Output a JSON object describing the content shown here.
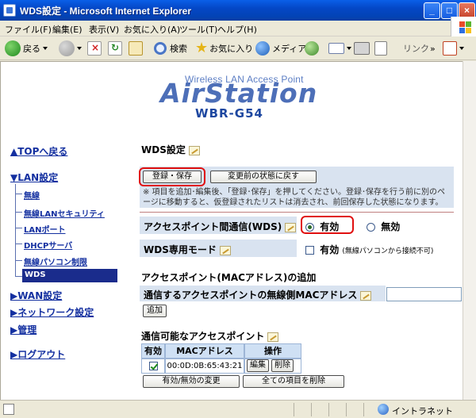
{
  "window": {
    "title": "WDS設定 - Microsoft Internet Explorer"
  },
  "menu": [
    "ファイル(F)",
    "編集(E)",
    "表示(V)",
    "お気に入り(A)",
    "ツール(T)",
    "ヘルプ(H)"
  ],
  "toolbar": {
    "back": "戻る",
    "search": "検索",
    "favorites": "お気に入り",
    "media": "メディア",
    "links": "リンク"
  },
  "logo": {
    "subtitle": "Wireless LAN Access Point",
    "brand": "AirStation",
    "model": "WBR-G54"
  },
  "nav": {
    "top": "▲TOPへ戻る",
    "lan": "▼LAN設定",
    "lan_items": [
      "無線",
      "無線LANセキュリティ",
      "LANポート",
      "DHCPサーバ",
      "無線パソコン制限",
      "WDS"
    ],
    "wan": "▶WAN設定",
    "network": "▶ネットワーク設定",
    "admin": "▶管理",
    "logout": "▶ログアウト"
  },
  "main": {
    "title": "WDS設定",
    "save_button": "登録・保存",
    "revert_button": "変更前の状態に戻す",
    "note": "※ 項目を追加･編集後、「登録･保存」を押してください。登録･保存を行う前に別のページに移動すると、仮登録されたリストは消去され、前回保存した状態になります。",
    "wds_label": "アクセスポイント間通信(WDS)",
    "enabled": "有効",
    "disabled": "無効",
    "wds_only_label": "WDS専用モード",
    "wds_only_enabled": "有効",
    "wds_only_note": "(無線パソコンから接続不可)",
    "add_heading": "アクセスポイント(MACアドレス)の追加",
    "mac_input_label": "通信するアクセスポイントの無線側MACアドレス",
    "mac_input_value": "",
    "add_button": "追加",
    "list_heading": "通信可能なアクセスポイント",
    "table": {
      "headers": [
        "有効",
        "MACアドレス",
        "操作"
      ],
      "rows": [
        {
          "mac": "00:0D:0B:65:43:21",
          "edit": "編集",
          "delete": "削除"
        }
      ]
    },
    "toggle_button": "有効/無効の変更",
    "delete_all_button": "全ての項目を削除"
  },
  "status": {
    "zone": "イントラネット"
  }
}
